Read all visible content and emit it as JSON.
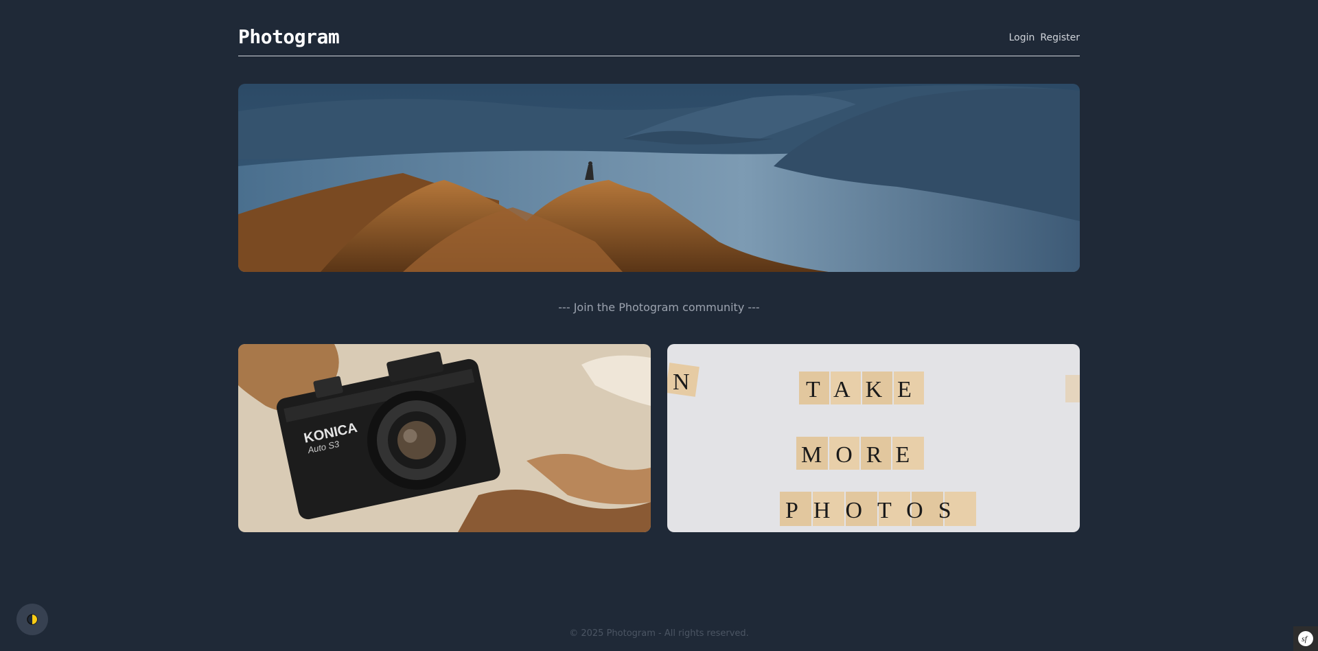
{
  "header": {
    "logo": "Photogram",
    "nav": {
      "login": "Login",
      "register": "Register"
    }
  },
  "hero": {
    "image": "mountain-lake-landscape"
  },
  "tagline": "--- Join the Photogram community ---",
  "cards": {
    "left": {
      "image": "vintage-camera-on-map",
      "camera_text": "KONICA",
      "camera_model": "Auto S3"
    },
    "right": {
      "image": "scrabble-tiles",
      "words": [
        "TAKE",
        "MORE",
        "PHOTOS"
      ],
      "edge_letter": "N"
    }
  },
  "footer": {
    "copyright": "© 2025 Photogram - All rights reserved."
  },
  "theme_toggle": {
    "icon": "half-moon-icon",
    "color": "#facc15"
  },
  "debug_badge": {
    "icon": "symfony-icon",
    "label": "sf"
  }
}
